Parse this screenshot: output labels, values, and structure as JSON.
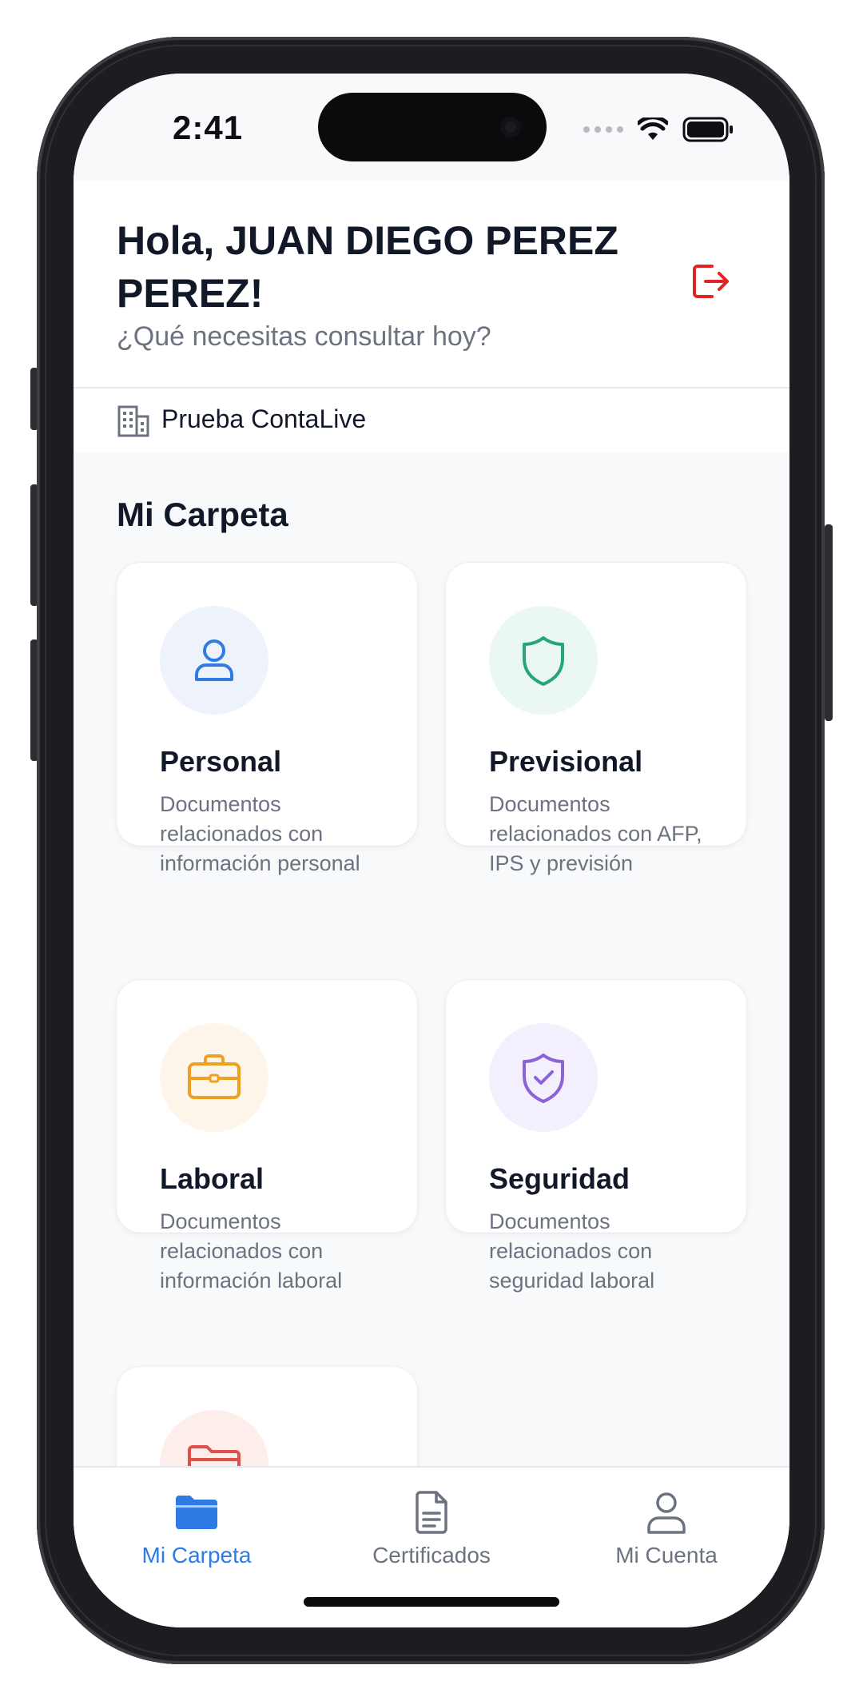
{
  "status_bar": {
    "time": "2:41"
  },
  "header": {
    "greeting": "Hola, JUAN DIEGO PEREZ PEREZ!",
    "subtitle": "¿Qué necesitas consultar hoy?",
    "logout_icon": "logout-icon"
  },
  "company": {
    "name": "Prueba ContaLive",
    "icon": "building-icon"
  },
  "section": {
    "title": "Mi Carpeta"
  },
  "cards": [
    {
      "title": "Personal",
      "description": "Documentos relacionados con información personal",
      "icon": "user-icon",
      "accent": "#2f7be5",
      "bg": "#eef3fb"
    },
    {
      "title": "Previsional",
      "description": "Documentos relacionados con AFP, IPS y previsión",
      "icon": "shield-icon",
      "accent": "#27a57a",
      "bg": "#eaf7f2"
    },
    {
      "title": "Laboral",
      "description": "Documentos relacionados con información laboral",
      "icon": "briefcase-icon",
      "accent": "#f0a020",
      "bg": "#fdf4ea"
    },
    {
      "title": "Seguridad",
      "description": "Documentos relacionados con seguridad laboral",
      "icon": "shield-check-icon",
      "accent": "#8a63d8",
      "bg": "#f3effc"
    },
    {
      "title": "",
      "description": "",
      "icon": "folder-icon",
      "accent": "#e0504a",
      "bg": "#fdeeec"
    }
  ],
  "tab_bar": {
    "tabs": [
      {
        "label": "Mi Carpeta",
        "icon": "folder-icon",
        "active": true
      },
      {
        "label": "Certificados",
        "icon": "document-icon",
        "active": false
      },
      {
        "label": "Mi Cuenta",
        "icon": "user-icon",
        "active": false
      }
    ],
    "active_color": "#2f7be5",
    "inactive_color": "#6b7280"
  }
}
